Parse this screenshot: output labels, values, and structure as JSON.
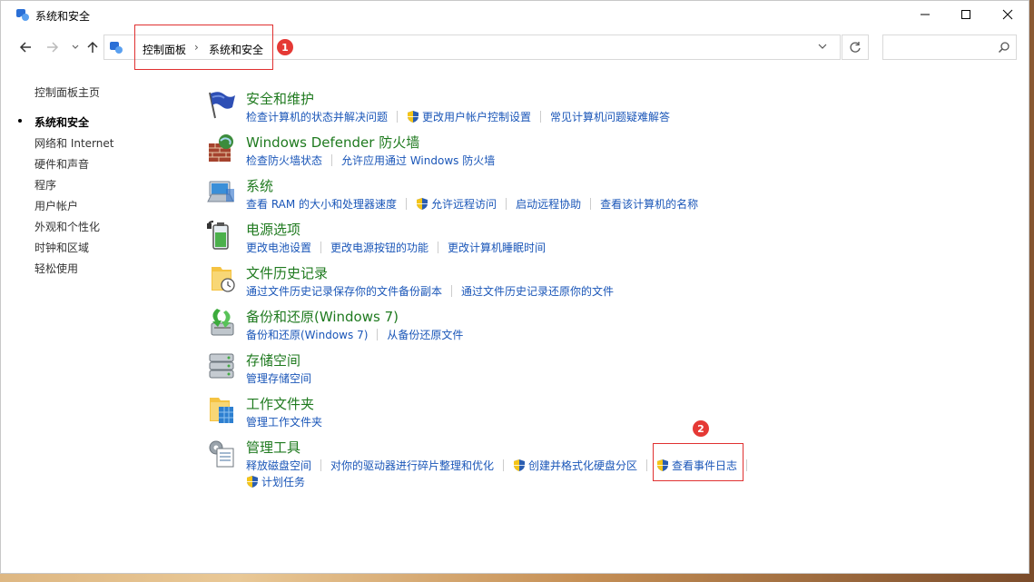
{
  "window": {
    "title": "系统和安全"
  },
  "nav": {
    "breadcrumb": [
      "控制面板",
      "系统和安全"
    ],
    "breadcrumb_sep": "›",
    "search_placeholder": ""
  },
  "annotations": {
    "badge1": "1",
    "badge2": "2"
  },
  "sidebar": {
    "items": [
      {
        "label": "控制面板主页"
      },
      {
        "label": "系统和安全"
      },
      {
        "label": "网络和 Internet"
      },
      {
        "label": "硬件和声音"
      },
      {
        "label": "程序"
      },
      {
        "label": "用户帐户"
      },
      {
        "label": "外观和个性化"
      },
      {
        "label": "时钟和区域"
      },
      {
        "label": "轻松使用"
      }
    ]
  },
  "categories": [
    {
      "title": "安全和维护",
      "icon": "flag-icon",
      "links": [
        {
          "label": "检查计算机的状态并解决问题",
          "shield": false
        },
        {
          "label": "更改用户帐户控制设置",
          "shield": true
        },
        {
          "label": "常见计算机问题疑难解答",
          "shield": false
        }
      ]
    },
    {
      "title": "Windows Defender 防火墙",
      "icon": "firewall-icon",
      "links": [
        {
          "label": "检查防火墙状态",
          "shield": false
        },
        {
          "label": "允许应用通过 Windows 防火墙",
          "shield": false
        }
      ]
    },
    {
      "title": "系统",
      "icon": "computer-icon",
      "links": [
        {
          "label": "查看 RAM 的大小和处理器速度",
          "shield": false
        },
        {
          "label": "允许远程访问",
          "shield": true
        },
        {
          "label": "启动远程协助",
          "shield": false
        },
        {
          "label": "查看该计算机的名称",
          "shield": false
        }
      ]
    },
    {
      "title": "电源选项",
      "icon": "battery-icon",
      "links": [
        {
          "label": "更改电池设置",
          "shield": false
        },
        {
          "label": "更改电源按钮的功能",
          "shield": false
        },
        {
          "label": "更改计算机睡眠时间",
          "shield": false
        }
      ]
    },
    {
      "title": "文件历史记录",
      "icon": "file-history-icon",
      "links": [
        {
          "label": "通过文件历史记录保存你的文件备份副本",
          "shield": false
        },
        {
          "label": "通过文件历史记录还原你的文件",
          "shield": false
        }
      ]
    },
    {
      "title": "备份和还原(Windows 7)",
      "icon": "backup-icon",
      "links": [
        {
          "label": "备份和还原(Windows 7)",
          "shield": false
        },
        {
          "label": "从备份还原文件",
          "shield": false
        }
      ]
    },
    {
      "title": "存储空间",
      "icon": "storage-icon",
      "links": [
        {
          "label": "管理存储空间",
          "shield": false
        }
      ]
    },
    {
      "title": "工作文件夹",
      "icon": "work-folder-icon",
      "links": [
        {
          "label": "管理工作文件夹",
          "shield": false
        }
      ]
    },
    {
      "title": "管理工具",
      "icon": "admin-tools-icon",
      "links": [
        {
          "label": "释放磁盘空间",
          "shield": false
        },
        {
          "label": "对你的驱动器进行碎片整理和优化",
          "shield": false
        },
        {
          "label": "创建并格式化硬盘分区",
          "shield": true
        },
        {
          "label": "查看事件日志",
          "shield": true
        }
      ],
      "links2": [
        {
          "label": "计划任务",
          "shield": true
        }
      ]
    }
  ]
}
